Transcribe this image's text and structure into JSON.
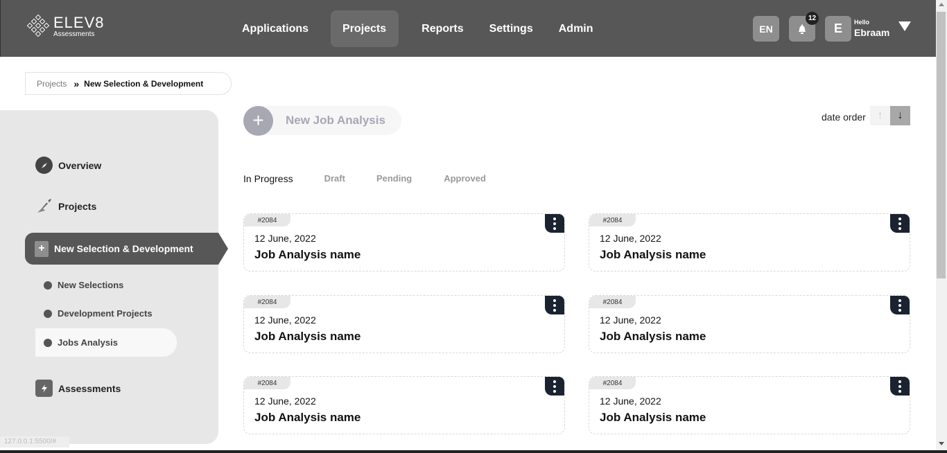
{
  "header": {
    "logo_brand": "ELEV8",
    "logo_sub": "Assessments",
    "nav": [
      {
        "label": "Applications"
      },
      {
        "label": "Projects"
      },
      {
        "label": "Reports"
      },
      {
        "label": "Settings"
      },
      {
        "label": "Admin"
      }
    ],
    "active_nav": "Projects",
    "language": "EN",
    "notification_count": "12",
    "avatar_initial": "E",
    "greeting": "Hello",
    "user_name": "Ebraam"
  },
  "breadcrumb": {
    "parent": "Projects",
    "current": "New Selection & Development"
  },
  "sidebar": {
    "overview": "Overview",
    "projects": "Projects",
    "active_section": "New Selection & Development",
    "sub_items": [
      {
        "label": "New Selections"
      },
      {
        "label": "Development Projects"
      },
      {
        "label": "Jobs Analysis"
      }
    ],
    "assessments": "Assessments",
    "url_hint": "127.0.0.1:5500/#"
  },
  "main": {
    "new_button_label": "New Job Analysis",
    "sort_label": "date order",
    "tabs": [
      {
        "label": "In Progress"
      },
      {
        "label": "Draft"
      },
      {
        "label": "Pending"
      },
      {
        "label": "Approved"
      }
    ],
    "active_tab": "In Progress",
    "cards": [
      {
        "id": "#2084",
        "date": "12 June, 2022",
        "name": "Job Analysis name"
      },
      {
        "id": "#2084",
        "date": "12 June, 2022",
        "name": "Job Analysis name"
      },
      {
        "id": "#2084",
        "date": "12 June, 2022",
        "name": "Job Analysis name"
      },
      {
        "id": "#2084",
        "date": "12 June, 2022",
        "name": "Job Analysis name"
      },
      {
        "id": "#2084",
        "date": "12 June, 2022",
        "name": "Job Analysis name"
      },
      {
        "id": "#2084",
        "date": "12 June, 2022",
        "name": "Job Analysis name"
      }
    ]
  },
  "colors": {
    "header_bg": "#575757",
    "sidebar_bg": "#e7e7e7",
    "card_menu_bg": "#1c2330"
  }
}
